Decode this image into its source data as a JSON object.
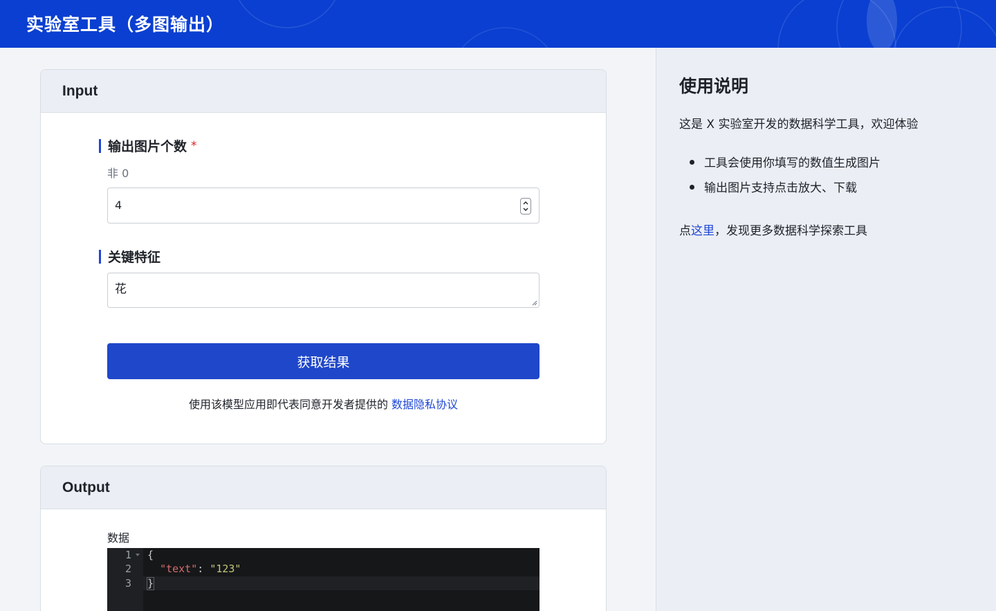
{
  "header": {
    "title": "实验室工具（多图输出）"
  },
  "input_card": {
    "heading": "Input",
    "count_field": {
      "label": "输出图片个数",
      "required_mark": "*",
      "hint": "非 0",
      "value": "4"
    },
    "feature_field": {
      "label": "关键特征",
      "value": "花"
    },
    "submit_label": "获取结果",
    "consent_text": "使用该模型应用即代表同意开发者提供的",
    "consent_link": "数据隐私协议"
  },
  "output_card": {
    "heading": "Output",
    "data_label": "数据",
    "line_numbers": [
      "1",
      "2",
      "3"
    ],
    "code": {
      "open": "{",
      "key": "\"text\"",
      "colon": ": ",
      "value": "\"123\"",
      "close": "}"
    }
  },
  "sidebar": {
    "heading": "使用说明",
    "intro": "这是 X 实验室开发的数据科学工具，欢迎体验",
    "bullets": [
      "工具会使用你填写的数值生成图片",
      "输出图片支持点击放大、下载"
    ],
    "footer_prefix": "点",
    "footer_link": "这里",
    "footer_suffix": "，发现更多数据科学探索工具"
  },
  "colors": {
    "header_bg": "#0a3fd1",
    "primary": "#1f47c9",
    "link": "#1e47d4",
    "required": "#e02424"
  }
}
